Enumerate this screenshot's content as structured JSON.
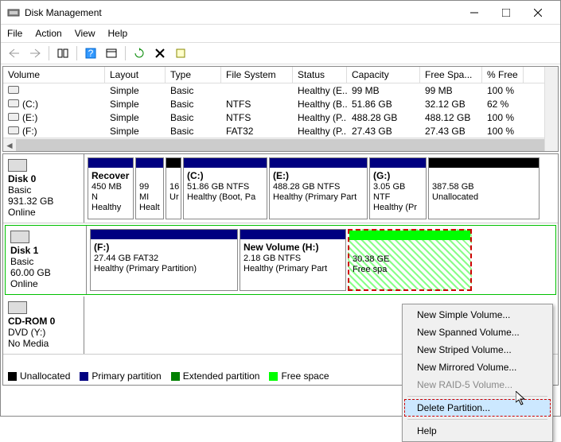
{
  "window": {
    "title": "Disk Management"
  },
  "menu": {
    "file": "File",
    "action": "Action",
    "view": "View",
    "help": "Help"
  },
  "columns": {
    "volume": "Volume",
    "layout": "Layout",
    "type": "Type",
    "fs": "File System",
    "status": "Status",
    "capacity": "Capacity",
    "free": "Free Spa...",
    "pct": "% Free"
  },
  "volumes": [
    {
      "vol": "",
      "layout": "Simple",
      "type": "Basic",
      "fs": "",
      "status": "Healthy (E...",
      "cap": "99 MB",
      "free": "99 MB",
      "pct": "100 %"
    },
    {
      "vol": "(C:)",
      "layout": "Simple",
      "type": "Basic",
      "fs": "NTFS",
      "status": "Healthy (B...",
      "cap": "51.86 GB",
      "free": "32.12 GB",
      "pct": "62 %"
    },
    {
      "vol": "(E:)",
      "layout": "Simple",
      "type": "Basic",
      "fs": "NTFS",
      "status": "Healthy (P...",
      "cap": "488.28 GB",
      "free": "488.12 GB",
      "pct": "100 %"
    },
    {
      "vol": "(F:)",
      "layout": "Simple",
      "type": "Basic",
      "fs": "FAT32",
      "status": "Healthy (P...",
      "cap": "27.43 GB",
      "free": "27.43 GB",
      "pct": "100 %"
    }
  ],
  "disks": [
    {
      "name": "Disk 0",
      "type": "Basic",
      "size": "931.32 GB",
      "state": "Online",
      "parts": [
        {
          "label": "Recover",
          "l2": "450 MB N",
          "l3": "Healthy",
          "bar": "navy",
          "w": 58
        },
        {
          "label": "",
          "l2": "99 MI",
          "l3": "Healt",
          "bar": "navy",
          "w": 36
        },
        {
          "label": "",
          "l2": "16",
          "l3": "Ur",
          "bar": "black",
          "w": 20
        },
        {
          "label": "(C:)",
          "l2": "51.86 GB NTFS",
          "l3": "Healthy (Boot, Pa",
          "bar": "navy",
          "w": 106
        },
        {
          "label": "(E:)",
          "l2": "488.28 GB NTFS",
          "l3": "Healthy (Primary Part",
          "bar": "navy",
          "w": 124
        },
        {
          "label": "(G:)",
          "l2": "3.05 GB NTF",
          "l3": "Healthy (Pr",
          "bar": "navy",
          "w": 72
        },
        {
          "label": "",
          "l2": "387.58 GB",
          "l3": "Unallocated",
          "bar": "black",
          "w": 140
        }
      ]
    },
    {
      "name": "Disk 1",
      "type": "Basic",
      "size": "60.00 GB",
      "state": "Online",
      "parts": [
        {
          "label": "(F:)",
          "l2": "27.44 GB FAT32",
          "l3": "Healthy (Primary Partition)",
          "bar": "navy",
          "w": 186
        },
        {
          "label": "New Volume  (H:)",
          "l2": "2.18 GB NTFS",
          "l3": "Healthy (Primary Part",
          "bar": "navy",
          "w": 134
        },
        {
          "label": "",
          "l2": "30.38 GE",
          "l3": "Free spa",
          "bar": "lime",
          "w": 156,
          "sel": true,
          "hatch": true
        }
      ]
    },
    {
      "name": "CD-ROM 0",
      "type": "DVD (Y:)",
      "size": "",
      "state": "No Media",
      "parts": []
    }
  ],
  "legend": {
    "unalloc": "Unallocated",
    "primary": "Primary partition",
    "ext": "Extended partition",
    "free": "Free space"
  },
  "context": {
    "i1": "New Simple Volume...",
    "i2": "New Spanned Volume...",
    "i3": "New Striped Volume...",
    "i4": "New Mirrored Volume...",
    "i5": "New RAID-5 Volume...",
    "del": "Delete Partition...",
    "help": "Help"
  }
}
